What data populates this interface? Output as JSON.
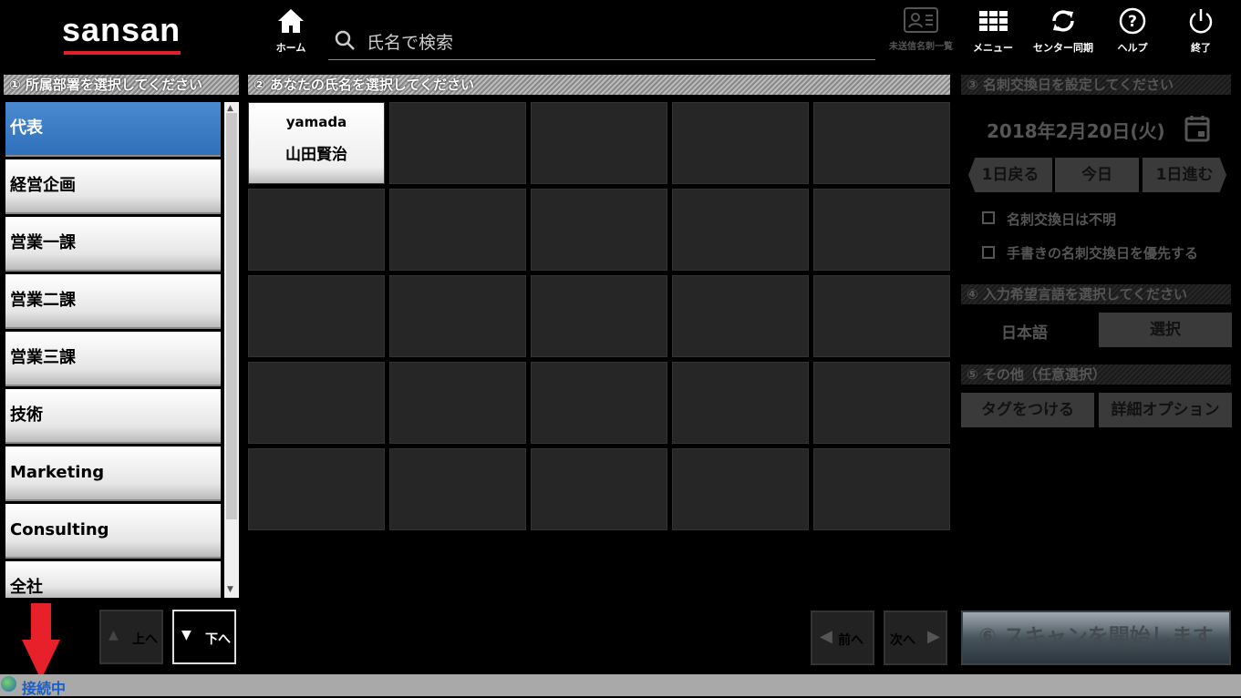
{
  "header": {
    "logo": "sansan",
    "home": "ホーム",
    "search_placeholder": "氏名で検索",
    "unsent": "未送信名刺一覧",
    "menu": "メニュー",
    "sync": "センター同期",
    "help": "ヘルプ",
    "exit": "終了"
  },
  "departments": {
    "title": "① 所属部署を選択してください",
    "items": [
      "代表",
      "経営企画",
      "営業一課",
      "営業二課",
      "営業三課",
      "技術",
      "Marketing",
      "Consulting",
      "全社"
    ],
    "up": "上へ",
    "down": "下へ"
  },
  "names": {
    "title": "② あなたの氏名を選択してください",
    "people": [
      {
        "id": "yamada",
        "name": "山田賢治"
      }
    ],
    "prev": "前へ",
    "next": "次へ"
  },
  "date": {
    "title": "③ 名刺交換日を設定してください",
    "value": "2018年2月20日(火)",
    "back": "1日戻る",
    "today": "今日",
    "forward": "1日進む",
    "unknown": "名刺交換日は不明",
    "handwritten": "手書きの名刺交換日を優先する"
  },
  "language": {
    "title": "④ 入力希望言語を選択してください",
    "value": "日本語",
    "select": "選択"
  },
  "other": {
    "title": "⑤ その他（任意選択）",
    "tag": "タグをつける",
    "options": "詳細オプション"
  },
  "scan": "⑥ スキャンを開始します",
  "status": "接続中"
}
